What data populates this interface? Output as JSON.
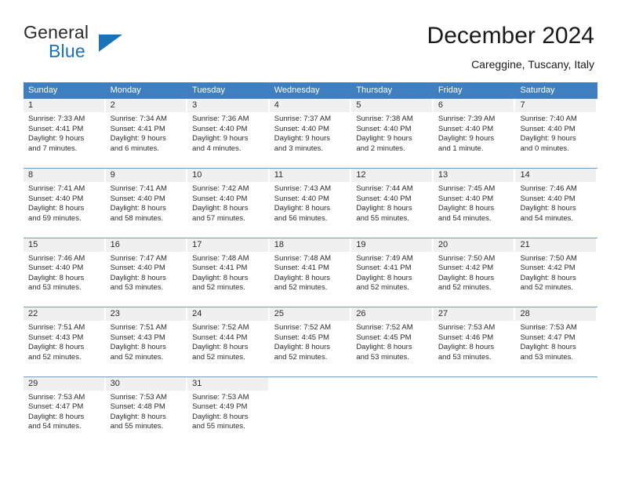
{
  "brand": {
    "name_part1": "General",
    "name_part2": "Blue",
    "triangle_color": "#1b72b8",
    "text_color": "#2b2b2b"
  },
  "header": {
    "title": "December 2024",
    "location": "Careggine, Tuscany, Italy"
  },
  "theme": {
    "header_bar_color": "#3f7fbf",
    "header_text_color": "#ffffff",
    "daynum_band_color": "#f0f0f0",
    "grid_line_color": "#6f9fcd",
    "body_text_color": "#2b2b2b"
  },
  "weekdays": [
    "Sunday",
    "Monday",
    "Tuesday",
    "Wednesday",
    "Thursday",
    "Friday",
    "Saturday"
  ],
  "labels": {
    "sunrise_prefix": "Sunrise:",
    "sunset_prefix": "Sunset:",
    "daylight_prefix": "Daylight:"
  },
  "weeks": [
    [
      {
        "day": "1",
        "sunrise": "Sunrise: 7:33 AM",
        "sunset": "Sunset: 4:41 PM",
        "daylight_line1": "Daylight: 9 hours",
        "daylight_line2": "and 7 minutes."
      },
      {
        "day": "2",
        "sunrise": "Sunrise: 7:34 AM",
        "sunset": "Sunset: 4:41 PM",
        "daylight_line1": "Daylight: 9 hours",
        "daylight_line2": "and 6 minutes."
      },
      {
        "day": "3",
        "sunrise": "Sunrise: 7:36 AM",
        "sunset": "Sunset: 4:40 PM",
        "daylight_line1": "Daylight: 9 hours",
        "daylight_line2": "and 4 minutes."
      },
      {
        "day": "4",
        "sunrise": "Sunrise: 7:37 AM",
        "sunset": "Sunset: 4:40 PM",
        "daylight_line1": "Daylight: 9 hours",
        "daylight_line2": "and 3 minutes."
      },
      {
        "day": "5",
        "sunrise": "Sunrise: 7:38 AM",
        "sunset": "Sunset: 4:40 PM",
        "daylight_line1": "Daylight: 9 hours",
        "daylight_line2": "and 2 minutes."
      },
      {
        "day": "6",
        "sunrise": "Sunrise: 7:39 AM",
        "sunset": "Sunset: 4:40 PM",
        "daylight_line1": "Daylight: 9 hours",
        "daylight_line2": "and 1 minute."
      },
      {
        "day": "7",
        "sunrise": "Sunrise: 7:40 AM",
        "sunset": "Sunset: 4:40 PM",
        "daylight_line1": "Daylight: 9 hours",
        "daylight_line2": "and 0 minutes."
      }
    ],
    [
      {
        "day": "8",
        "sunrise": "Sunrise: 7:41 AM",
        "sunset": "Sunset: 4:40 PM",
        "daylight_line1": "Daylight: 8 hours",
        "daylight_line2": "and 59 minutes."
      },
      {
        "day": "9",
        "sunrise": "Sunrise: 7:41 AM",
        "sunset": "Sunset: 4:40 PM",
        "daylight_line1": "Daylight: 8 hours",
        "daylight_line2": "and 58 minutes."
      },
      {
        "day": "10",
        "sunrise": "Sunrise: 7:42 AM",
        "sunset": "Sunset: 4:40 PM",
        "daylight_line1": "Daylight: 8 hours",
        "daylight_line2": "and 57 minutes."
      },
      {
        "day": "11",
        "sunrise": "Sunrise: 7:43 AM",
        "sunset": "Sunset: 4:40 PM",
        "daylight_line1": "Daylight: 8 hours",
        "daylight_line2": "and 56 minutes."
      },
      {
        "day": "12",
        "sunrise": "Sunrise: 7:44 AM",
        "sunset": "Sunset: 4:40 PM",
        "daylight_line1": "Daylight: 8 hours",
        "daylight_line2": "and 55 minutes."
      },
      {
        "day": "13",
        "sunrise": "Sunrise: 7:45 AM",
        "sunset": "Sunset: 4:40 PM",
        "daylight_line1": "Daylight: 8 hours",
        "daylight_line2": "and 54 minutes."
      },
      {
        "day": "14",
        "sunrise": "Sunrise: 7:46 AM",
        "sunset": "Sunset: 4:40 PM",
        "daylight_line1": "Daylight: 8 hours",
        "daylight_line2": "and 54 minutes."
      }
    ],
    [
      {
        "day": "15",
        "sunrise": "Sunrise: 7:46 AM",
        "sunset": "Sunset: 4:40 PM",
        "daylight_line1": "Daylight: 8 hours",
        "daylight_line2": "and 53 minutes."
      },
      {
        "day": "16",
        "sunrise": "Sunrise: 7:47 AM",
        "sunset": "Sunset: 4:40 PM",
        "daylight_line1": "Daylight: 8 hours",
        "daylight_line2": "and 53 minutes."
      },
      {
        "day": "17",
        "sunrise": "Sunrise: 7:48 AM",
        "sunset": "Sunset: 4:41 PM",
        "daylight_line1": "Daylight: 8 hours",
        "daylight_line2": "and 52 minutes."
      },
      {
        "day": "18",
        "sunrise": "Sunrise: 7:48 AM",
        "sunset": "Sunset: 4:41 PM",
        "daylight_line1": "Daylight: 8 hours",
        "daylight_line2": "and 52 minutes."
      },
      {
        "day": "19",
        "sunrise": "Sunrise: 7:49 AM",
        "sunset": "Sunset: 4:41 PM",
        "daylight_line1": "Daylight: 8 hours",
        "daylight_line2": "and 52 minutes."
      },
      {
        "day": "20",
        "sunrise": "Sunrise: 7:50 AM",
        "sunset": "Sunset: 4:42 PM",
        "daylight_line1": "Daylight: 8 hours",
        "daylight_line2": "and 52 minutes."
      },
      {
        "day": "21",
        "sunrise": "Sunrise: 7:50 AM",
        "sunset": "Sunset: 4:42 PM",
        "daylight_line1": "Daylight: 8 hours",
        "daylight_line2": "and 52 minutes."
      }
    ],
    [
      {
        "day": "22",
        "sunrise": "Sunrise: 7:51 AM",
        "sunset": "Sunset: 4:43 PM",
        "daylight_line1": "Daylight: 8 hours",
        "daylight_line2": "and 52 minutes."
      },
      {
        "day": "23",
        "sunrise": "Sunrise: 7:51 AM",
        "sunset": "Sunset: 4:43 PM",
        "daylight_line1": "Daylight: 8 hours",
        "daylight_line2": "and 52 minutes."
      },
      {
        "day": "24",
        "sunrise": "Sunrise: 7:52 AM",
        "sunset": "Sunset: 4:44 PM",
        "daylight_line1": "Daylight: 8 hours",
        "daylight_line2": "and 52 minutes."
      },
      {
        "day": "25",
        "sunrise": "Sunrise: 7:52 AM",
        "sunset": "Sunset: 4:45 PM",
        "daylight_line1": "Daylight: 8 hours",
        "daylight_line2": "and 52 minutes."
      },
      {
        "day": "26",
        "sunrise": "Sunrise: 7:52 AM",
        "sunset": "Sunset: 4:45 PM",
        "daylight_line1": "Daylight: 8 hours",
        "daylight_line2": "and 53 minutes."
      },
      {
        "day": "27",
        "sunrise": "Sunrise: 7:53 AM",
        "sunset": "Sunset: 4:46 PM",
        "daylight_line1": "Daylight: 8 hours",
        "daylight_line2": "and 53 minutes."
      },
      {
        "day": "28",
        "sunrise": "Sunrise: 7:53 AM",
        "sunset": "Sunset: 4:47 PM",
        "daylight_line1": "Daylight: 8 hours",
        "daylight_line2": "and 53 minutes."
      }
    ],
    [
      {
        "day": "29",
        "sunrise": "Sunrise: 7:53 AM",
        "sunset": "Sunset: 4:47 PM",
        "daylight_line1": "Daylight: 8 hours",
        "daylight_line2": "and 54 minutes."
      },
      {
        "day": "30",
        "sunrise": "Sunrise: 7:53 AM",
        "sunset": "Sunset: 4:48 PM",
        "daylight_line1": "Daylight: 8 hours",
        "daylight_line2": "and 55 minutes."
      },
      {
        "day": "31",
        "sunrise": "Sunrise: 7:53 AM",
        "sunset": "Sunset: 4:49 PM",
        "daylight_line1": "Daylight: 8 hours",
        "daylight_line2": "and 55 minutes."
      },
      {
        "day": "",
        "sunrise": "",
        "sunset": "",
        "daylight_line1": "",
        "daylight_line2": ""
      },
      {
        "day": "",
        "sunrise": "",
        "sunset": "",
        "daylight_line1": "",
        "daylight_line2": ""
      },
      {
        "day": "",
        "sunrise": "",
        "sunset": "",
        "daylight_line1": "",
        "daylight_line2": ""
      },
      {
        "day": "",
        "sunrise": "",
        "sunset": "",
        "daylight_line1": "",
        "daylight_line2": ""
      }
    ]
  ]
}
